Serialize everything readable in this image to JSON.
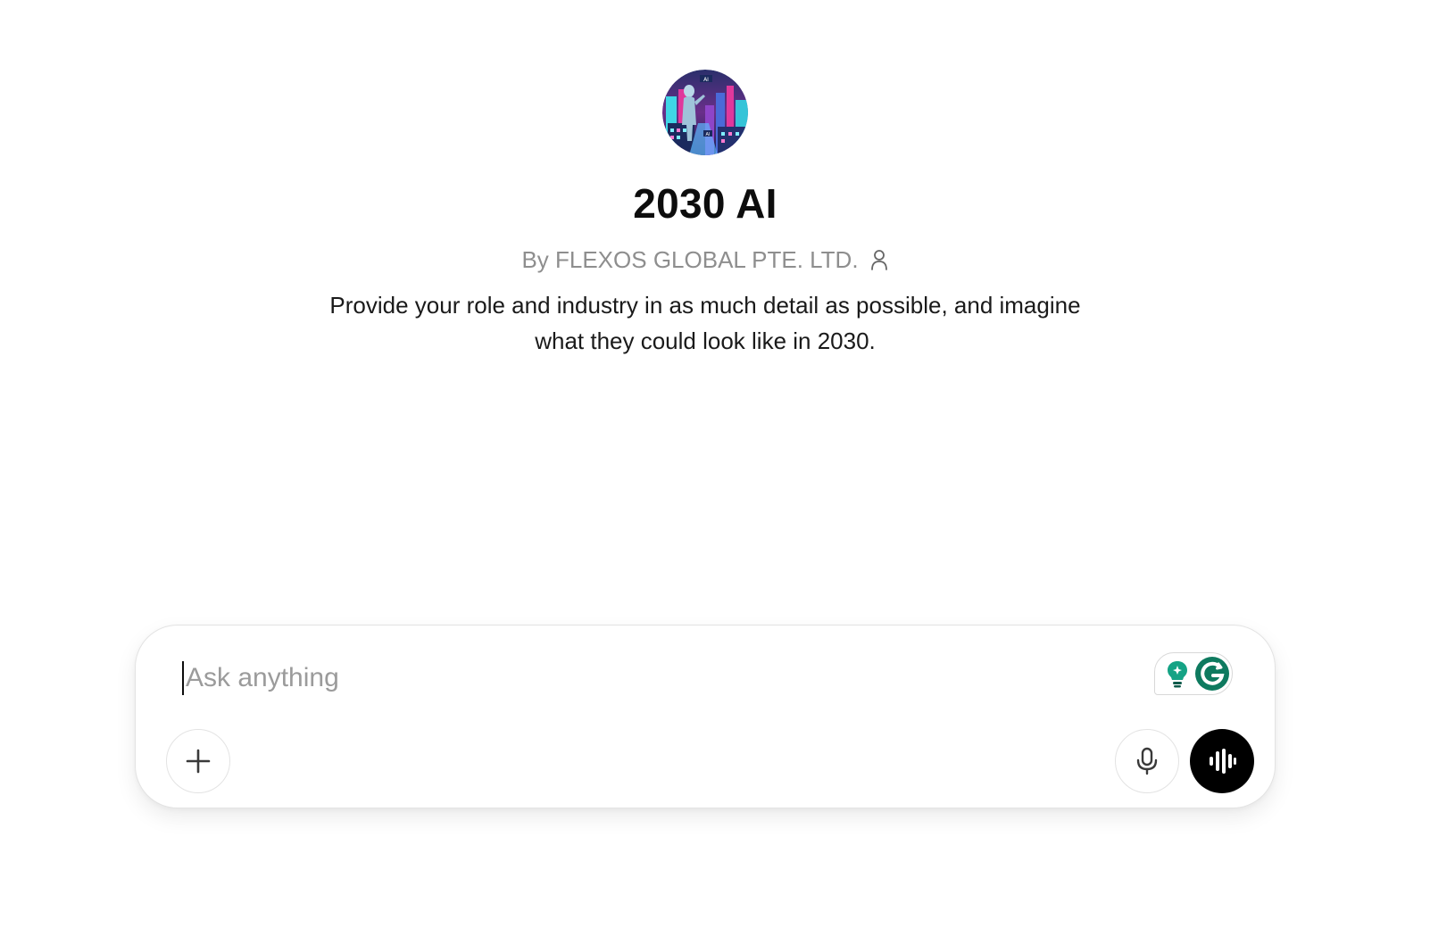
{
  "gpt": {
    "title": "2030 AI",
    "author": "By FLEXOS GLOBAL PTE. LTD.",
    "description": "Provide your role and industry in as much detail as possible, and imagine what they could look like in 2030.",
    "avatar_icon": "futuristic-robot-city-avatar",
    "author_icon": "person-icon"
  },
  "composer": {
    "placeholder": "Ask anything",
    "value": "",
    "attach_icon": "plus-icon",
    "mic_icon": "microphone-icon",
    "voice_icon": "voice-waveform-icon",
    "extension_icons": [
      "lightbulb-icon",
      "grammarly-icon"
    ]
  },
  "colors": {
    "voice_button_bg": "#000000",
    "grammarly_green": "#15a385",
    "grammarly_dark": "#0e7a5f",
    "muted_text": "#8e8e8e"
  }
}
